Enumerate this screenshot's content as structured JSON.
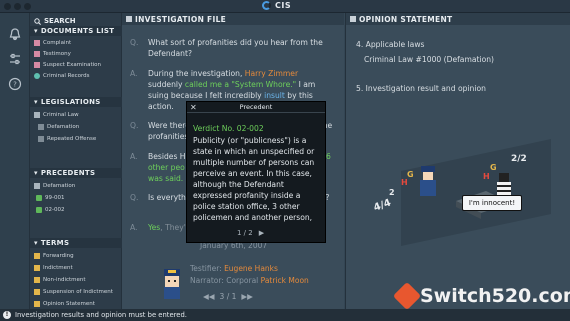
{
  "window": {
    "title": "CIS"
  },
  "sidebar": {
    "search_label": "SEARCH",
    "sections": [
      {
        "title": "DOCUMENTS LIST",
        "items": [
          "Complaint",
          "Testimony",
          "Suspect Examination",
          "Criminal Records"
        ]
      },
      {
        "title": "LEGISLATIONS",
        "items": [
          "Criminal Law",
          "Defamation",
          "Repeated Offense"
        ]
      },
      {
        "title": "PRECEDENTS",
        "items": [
          "Defamation",
          "99-001",
          "02-002"
        ]
      },
      {
        "title": "TERMS",
        "items": [
          "Forwarding",
          "Indictment",
          "Non-indictment",
          "Suspension of Indictment",
          "Opinion Statement"
        ]
      }
    ]
  },
  "investigation": {
    "header": "INVESTIGATION FILE",
    "q1_label": "Q.",
    "q1": "What sort of profanities did you hear from the Defendant?",
    "a1_label": "A.",
    "a1_pre": "During the investigation, ",
    "a1_name": "Harry Zimmer",
    "a1_mid1": " suddenly ",
    "a1_called": "called me a \"System Whore.\"",
    "a1_mid2": " I am suing because I felt incredibly ",
    "a1_insult": "insult",
    "a1_post": " by this action.",
    "q2_label": "Q.",
    "q2": "Were there any other people who also heard the profanities?",
    "a2_label": "A.",
    "a2_pre": "Besides H",
    "a2_tail": "6",
    "a2_line2": "other peo",
    "a2_line3": "was said.",
    "q3_label": "Q.",
    "q3": "Is everything you have testified about are true?",
    "a3_label": "A.",
    "a3_yes": "Yes",
    "a3_rest": ", They're all true.",
    "date": "January 6th, 2007",
    "testifier_label": "Testifier: ",
    "testifier": "Eugene Hanks",
    "narrator_label": "Narrator: Corporal ",
    "narrator": "Patrick Moon",
    "pager": "3 / 1"
  },
  "opinion": {
    "header": "OPINION STATEMENT",
    "item4": "4. Applicable laws",
    "law": "Criminal Law #1000 (Defamation)",
    "item5": "5. Investigation result and opinion"
  },
  "popup": {
    "header": "Precedent",
    "title": "Verdict No. 02-002",
    "body": "Publicity (or \"publicness\") is a state in which an unspecified or multiple number of persons can perceive an event. In this case, although the Defendant expressed profanity inside a police station office, 3 other policemen and another person,",
    "page": "1 / 2"
  },
  "bubble": "I'm innocent!",
  "status": "Investigation results and opinion must be entered.",
  "watermark": "Switch520.com",
  "colors": {
    "accent_orange": "#e58a3b",
    "accent_green": "#6ed05b",
    "accent_blue": "#6cb6ec",
    "accent_red": "#e54a3e"
  }
}
